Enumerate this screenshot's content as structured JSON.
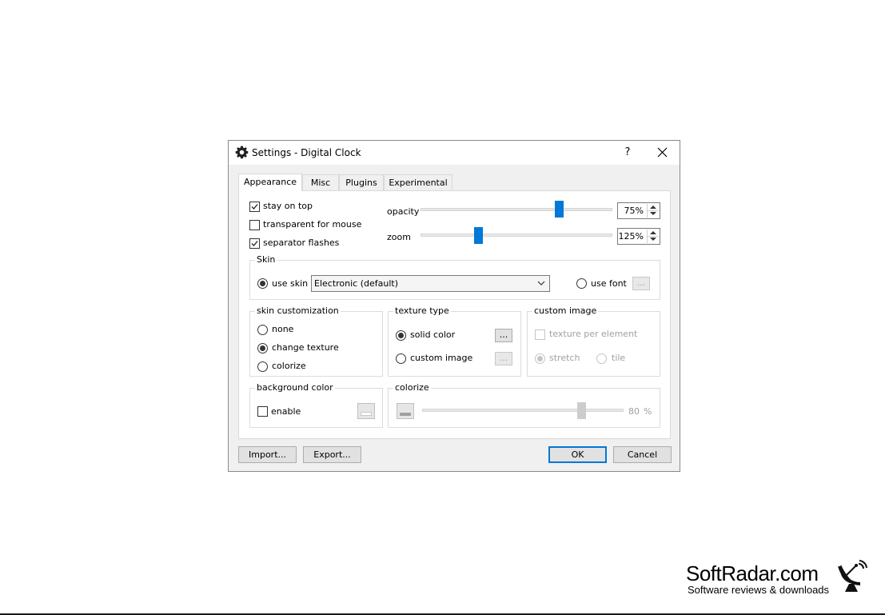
{
  "window": {
    "title": "Settings - Digital Clock",
    "help_label": "?"
  },
  "tabs": [
    {
      "label": "Appearance",
      "active": true
    },
    {
      "label": "Misc",
      "active": false
    },
    {
      "label": "Plugins",
      "active": false
    },
    {
      "label": "Experimental",
      "active": false
    }
  ],
  "options": {
    "stay_on_top": {
      "label": "stay on top",
      "checked": true
    },
    "transparent_for_mouse": {
      "label": "transparent for mouse",
      "checked": false
    },
    "separator_flashes": {
      "label": "separator flashes",
      "checked": true
    }
  },
  "opacity": {
    "label": "opacity",
    "value": "75%",
    "level": 0.75
  },
  "zoom": {
    "label": "zoom",
    "value": "125%",
    "level": 0.3
  },
  "skin": {
    "group_label": "Skin",
    "use_skin_label": "use skin",
    "use_skin_selected": true,
    "selected_skin": "Electronic (default)",
    "use_font_label": "use font",
    "font_button_label": "..."
  },
  "skin_customization": {
    "group_label": "skin customization",
    "options": [
      "none",
      "change texture",
      "colorize"
    ],
    "selected": "change texture"
  },
  "texture_type": {
    "group_label": "texture type",
    "solid_color_label": "solid color",
    "custom_image_label": "custom image",
    "selected": "solid color",
    "button_label": "..."
  },
  "custom_image": {
    "group_label": "custom image",
    "texture_per_element_label": "texture per element",
    "stretch_label": "stretch",
    "tile_label": "tile"
  },
  "background_color": {
    "group_label": "background color",
    "enable_label": "enable"
  },
  "colorize": {
    "group_label": "colorize",
    "value": "80",
    "unit": "%",
    "level": 0.8
  },
  "buttons": {
    "import": "Import...",
    "export": "Export...",
    "ok": "OK",
    "cancel": "Cancel"
  },
  "colors": {
    "accent": "#0078d7",
    "dialog_bg": "#f0f0f0"
  },
  "watermark": {
    "title": "SoftRadar.com",
    "subtitle": "Software reviews & downloads"
  }
}
